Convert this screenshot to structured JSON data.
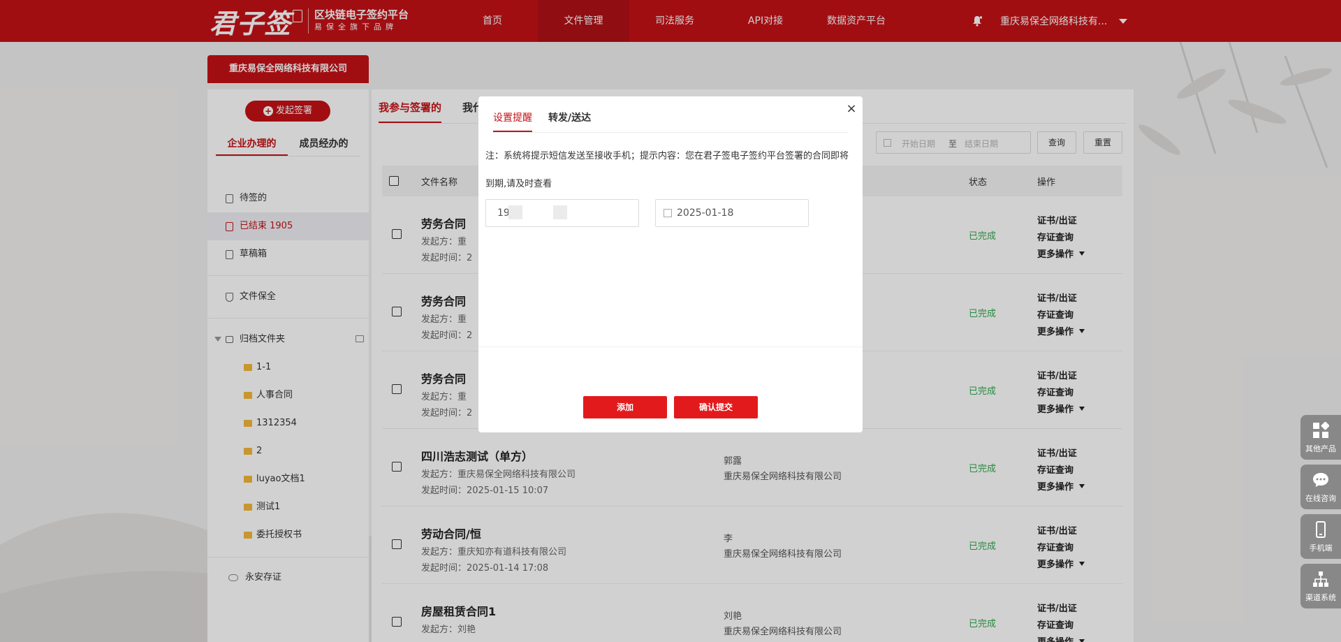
{
  "header": {
    "logo_main": "君子签",
    "logo_line1": "区块链电子签约平台",
    "logo_line2": "易保全旗下品牌",
    "nav": [
      {
        "label": "首页",
        "active": false
      },
      {
        "label": "文件管理",
        "active": true
      },
      {
        "label": "司法服务",
        "active": false
      },
      {
        "label": "API对接",
        "active": false
      },
      {
        "label": "数据资产平台",
        "active": false
      }
    ],
    "org_name": "重庆易保全网络科技有..."
  },
  "sidebar": {
    "company": "重庆易保全网络科技有限公司",
    "start_sign": "发起签署",
    "tabs": [
      "企业办理的",
      "成员经办的"
    ],
    "items": [
      {
        "label": "待签的"
      },
      {
        "label": "已结束  1905"
      },
      {
        "label": "草稿箱"
      }
    ],
    "file_preserve": "文件保全",
    "archive_folder": "归档文件夹",
    "folders": [
      "1-1",
      "人事合同",
      "1312354",
      "2",
      "luyao文档1",
      "测试1",
      "委托授权书"
    ],
    "yongan": "永安存证"
  },
  "main": {
    "tabs": [
      "我参与签署的",
      "我代"
    ],
    "date_start_placeholder": "开始日期",
    "date_sep": "至",
    "date_end_placeholder": "结束日期",
    "query": "查询",
    "reset": "重置",
    "col_file": "文件名称",
    "col_status": "状态",
    "col_ops": "操作",
    "sender_label": "发起方：",
    "time_label": "发起时间：",
    "ops": [
      "证书/出证",
      "存证查询",
      "更多操作"
    ],
    "rows": [
      {
        "title": "劳务合同",
        "sender": "重",
        "time": "2",
        "signer_name": "",
        "signer_org": "",
        "status": "已完成"
      },
      {
        "title": "劳务合同",
        "sender": "重",
        "time": "2",
        "signer_name": "",
        "signer_org": "",
        "status": "已完成"
      },
      {
        "title": "劳务合同",
        "sender": "重",
        "time": "2",
        "signer_name": "",
        "signer_org": "",
        "status": "已完成"
      },
      {
        "title": "四川浩志测试（单方）",
        "sender": "重庆易保全网络科技有限公司",
        "time": "2025-01-15 10:07",
        "signer_name": "郭露",
        "signer_org": "重庆易保全网络科技有限公司",
        "status": "已完成"
      },
      {
        "title": "劳动合同/恒",
        "sender": "重庆知亦有道科技有限公司",
        "time": "2025-01-14 17:08",
        "signer_name": "李",
        "signer_org": "重庆易保全网络科技有限公司",
        "status": "已完成"
      },
      {
        "title": "房屋租赁合同1",
        "sender": "刘艳",
        "time": "",
        "signer_name": "刘艳",
        "signer_org": "重庆易保全网络科技有限公司",
        "status": "已完成"
      }
    ]
  },
  "modal": {
    "tabs": [
      "设置提醒",
      "转发/送达"
    ],
    "close": "×",
    "note": "注：系统将提示短信发送至接收手机；提示内容：您在君子签电子签约平台签署的合同即将到期,请及时查看",
    "phone_value": "19",
    "date_value": "2025-01-18",
    "add_btn": "添加",
    "submit_btn": "确认提交"
  },
  "float_tools": [
    "其他产品",
    "在线咨询",
    "手机端",
    "渠道系统"
  ],
  "colors": {
    "brand": "#c51217",
    "success": "#2fa94c",
    "button": "#e31a1c"
  }
}
